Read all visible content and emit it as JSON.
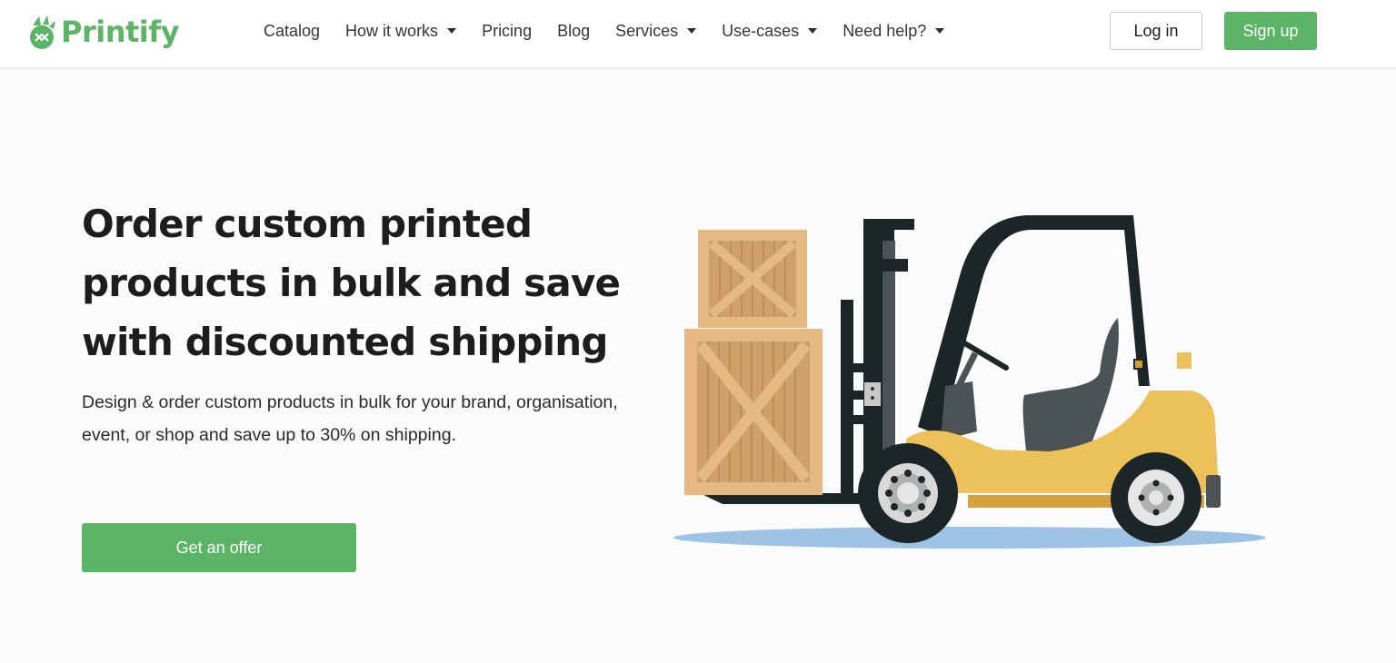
{
  "brand": {
    "name": "Printify",
    "accent": "#5cb567"
  },
  "nav": {
    "items": [
      {
        "label": "Catalog",
        "dropdown": false
      },
      {
        "label": "How it works",
        "dropdown": true
      },
      {
        "label": "Pricing",
        "dropdown": false
      },
      {
        "label": "Blog",
        "dropdown": false
      },
      {
        "label": "Services",
        "dropdown": true
      },
      {
        "label": "Use-cases",
        "dropdown": true
      },
      {
        "label": "Need help?",
        "dropdown": true
      }
    ],
    "login_label": "Log in",
    "signup_label": "Sign up"
  },
  "hero": {
    "title": "Order custom printed products in bulk and save with discounted shipping",
    "subtitle": "Design & order custom products in bulk for your brand, organisation, event, or shop and save up to 30% on shipping.",
    "cta_label": "Get an offer"
  },
  "illustration": {
    "icon": "forklift-with-crates-illustration"
  }
}
